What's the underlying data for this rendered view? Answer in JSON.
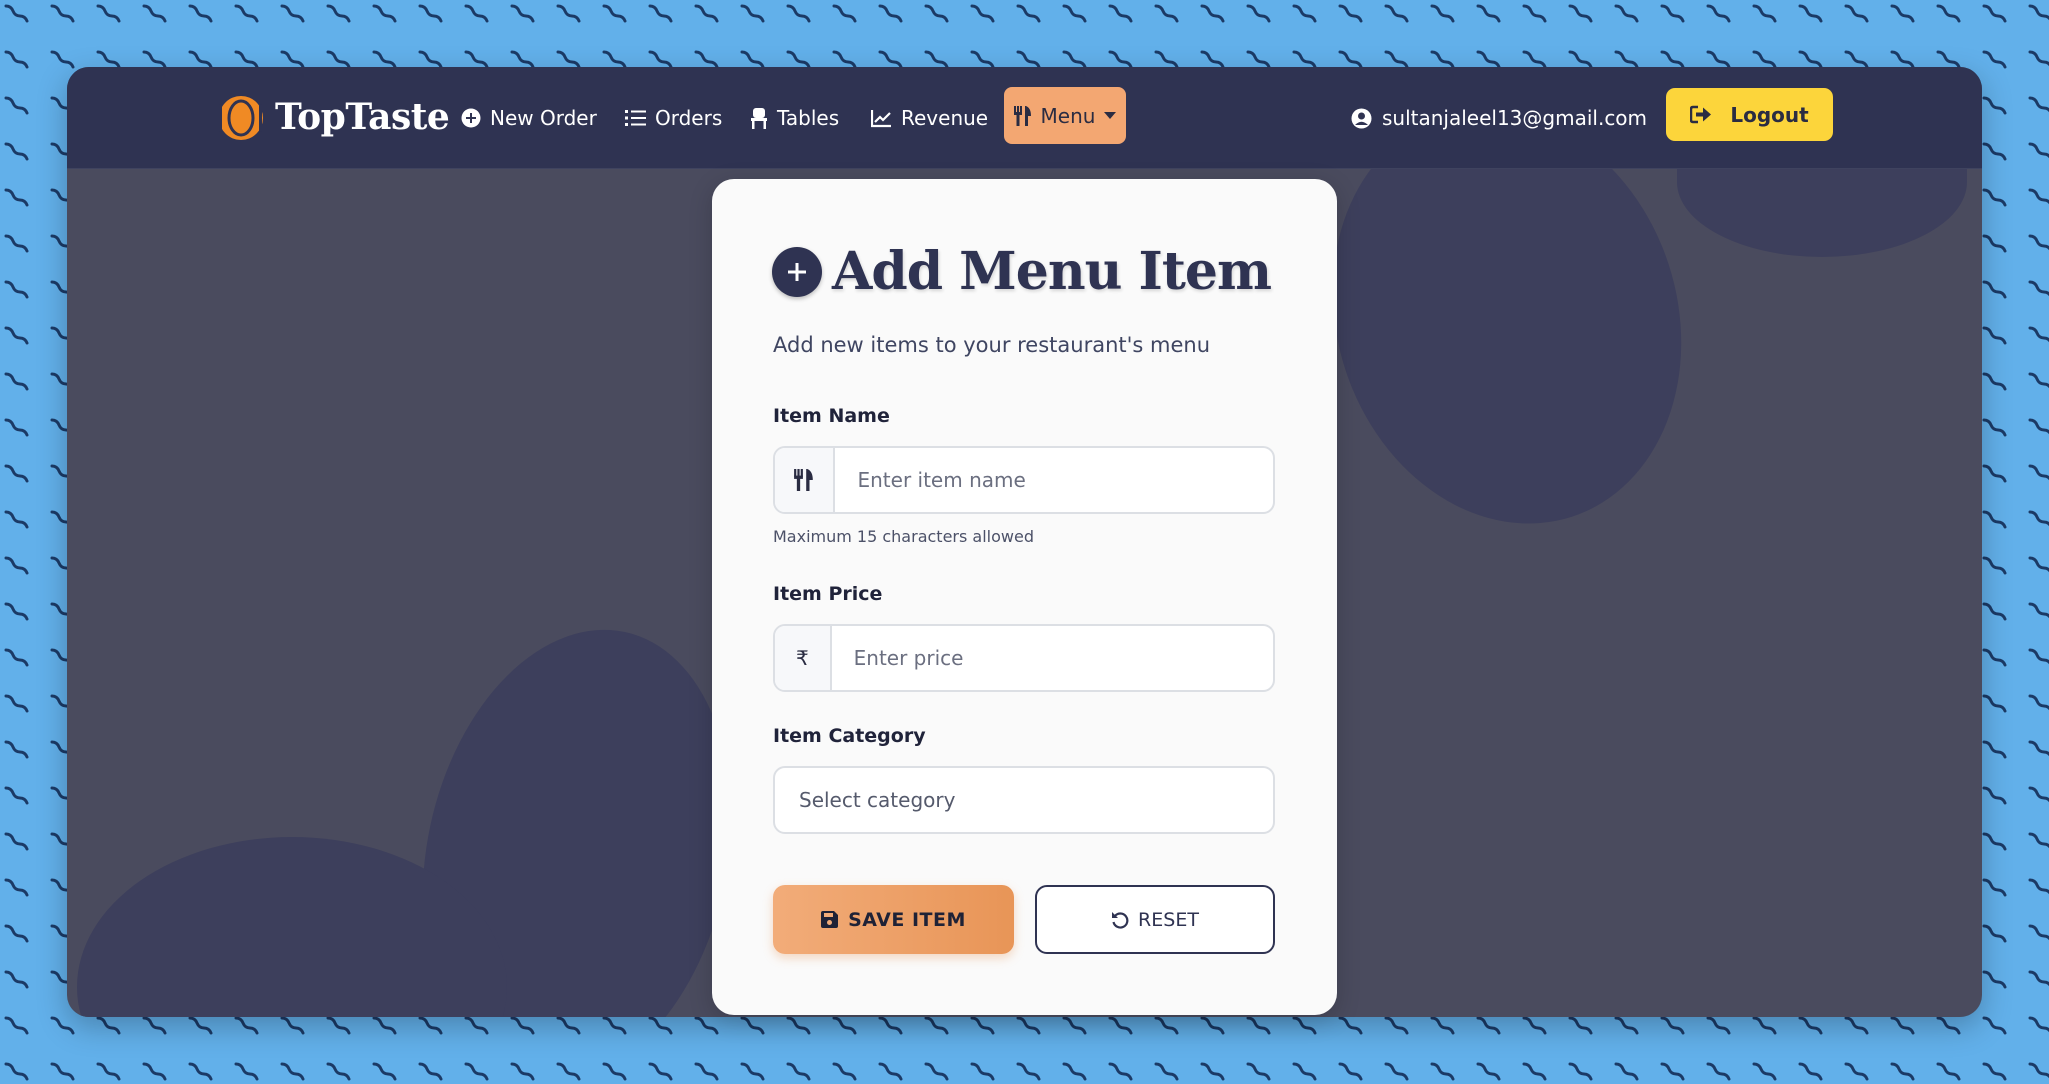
{
  "brand": {
    "name": "TopTaste"
  },
  "nav": {
    "items": [
      {
        "label": "New Order",
        "icon": "plus-circle-icon"
      },
      {
        "label": "Orders",
        "icon": "list-icon"
      },
      {
        "label": "Tables",
        "icon": "chair-icon"
      },
      {
        "label": "Revenue",
        "icon": "chart-line-icon"
      }
    ],
    "menu": {
      "label": "Menu",
      "icon": "utensils-icon"
    },
    "user_email": "sultanjaleel13@gmail.com",
    "logout_label": "Logout"
  },
  "form": {
    "title": "Add Menu Item",
    "subtitle": "Add new items to your restaurant's menu",
    "item_name": {
      "label": "Item Name",
      "placeholder": "Enter item name",
      "hint": "Maximum 15 characters allowed",
      "value": ""
    },
    "item_price": {
      "label": "Item Price",
      "currency_symbol": "₹",
      "placeholder": "Enter price",
      "value": ""
    },
    "item_category": {
      "label": "Item Category",
      "selected": "Select category"
    },
    "save_label": "SAVE ITEM",
    "reset_label": "RESET"
  },
  "colors": {
    "navbar": "#2f3352",
    "accent": "#f3a772",
    "logout": "#fcd53b",
    "page_bg": "#62b0ea"
  }
}
